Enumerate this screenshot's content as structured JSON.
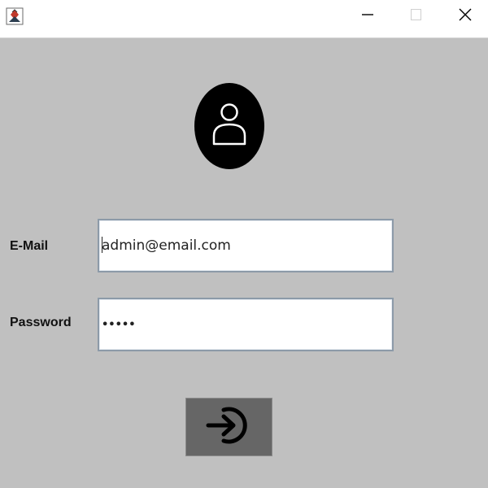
{
  "window": {
    "title_icon": "java-app-icon",
    "controls": [
      "minimize-icon",
      "maximize-icon",
      "close-icon"
    ]
  },
  "avatar": {
    "icon": "user-icon"
  },
  "form": {
    "email_label": "E-Mail",
    "email_value": "admin@email.com",
    "password_label": "Password",
    "password_value": "•••••"
  },
  "login_button": {
    "icon": "sign-in-icon"
  },
  "colors": {
    "background": "#c0c0c0",
    "titlebar": "#ffffff",
    "button": "#666666",
    "avatar": "#000000"
  }
}
